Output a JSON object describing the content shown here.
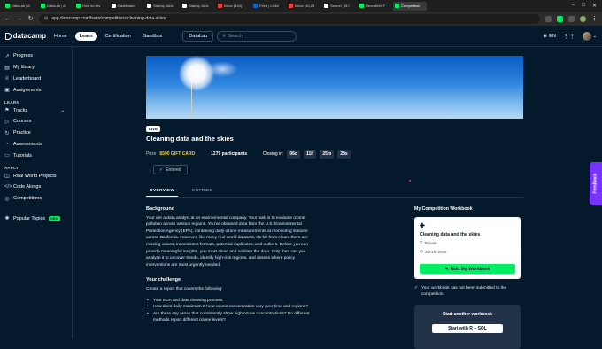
{
  "browser": {
    "tabs": [
      {
        "label": "DataLab | A",
        "color": "#03ef62"
      },
      {
        "label": "DataLab | A",
        "color": "#03ef62"
      },
      {
        "label": "How do res",
        "color": "#03ef62"
      },
      {
        "label": "Dashboard",
        "color": "#ffffff"
      },
      {
        "label": "Startup Jobs",
        "color": "#ffffff"
      },
      {
        "label": "Startup Jobs",
        "color": "#ffffff"
      },
      {
        "label": "Inbox (444)",
        "color": "#ea4335"
      },
      {
        "label": "Feed | Linke",
        "color": "#0a66c2"
      },
      {
        "label": "Inbox (40,23",
        "color": "#ea4335"
      },
      {
        "label": "Search | M.I",
        "color": "#ffffff"
      },
      {
        "label": "Recruiterd F",
        "color": "#03ef62"
      },
      {
        "label": "Competition",
        "color": "#03ef62"
      }
    ],
    "url": "app.datacamp.com/learn/competitions/cleaning-data-skies",
    "window_controls": {
      "minimize": "–",
      "maximize": "□",
      "close": "✕"
    }
  },
  "topbar": {
    "logo_text": "datacamp",
    "nav": [
      "Home",
      "Learn",
      "Certification",
      "Sandbox"
    ],
    "active_nav": "Learn",
    "datalab_label": "DataLab",
    "search_placeholder": "Search",
    "language": "EN"
  },
  "sidebar": {
    "group1": [
      {
        "label": "Progress",
        "icon": "progress-icon",
        "glyph": "↗"
      },
      {
        "label": "My library",
        "icon": "library-icon",
        "glyph": "▤"
      },
      {
        "label": "Leaderboard",
        "icon": "leaderboard-icon",
        "glyph": "♕"
      },
      {
        "label": "Assignments",
        "icon": "assignments-icon",
        "glyph": "▣"
      }
    ],
    "learn_heading": "LEARN",
    "group2": [
      {
        "label": "Tracks",
        "icon": "tracks-icon",
        "glyph": "⚑"
      },
      {
        "label": "Courses",
        "icon": "courses-icon",
        "glyph": "▷"
      },
      {
        "label": "Practice",
        "icon": "practice-icon",
        "glyph": "↻"
      },
      {
        "label": "Assessments",
        "icon": "assessments-icon",
        "glyph": "◔"
      },
      {
        "label": "Tutorials",
        "icon": "tutorials-icon",
        "glyph": "▭"
      }
    ],
    "apply_heading": "APPLY",
    "group3": [
      {
        "label": "Real World Projects",
        "icon": "projects-icon",
        "glyph": "◫"
      },
      {
        "label": "Code Alongs",
        "icon": "code-alongs-icon",
        "glyph": "</>"
      },
      {
        "label": "Competitions",
        "icon": "competitions-icon",
        "glyph": "◎"
      }
    ],
    "popular_topics": "Popular Topics",
    "new_badge": "NEW"
  },
  "competition": {
    "live_badge": "LIVE",
    "title": "Cleaning data and the skies",
    "prize_label": "Prize",
    "prize_value": "$500 GIFT CARD",
    "participants": "1279 participants",
    "closing_label": "Closing in:",
    "countdown": [
      "06d",
      "11h",
      "25m",
      "28s"
    ],
    "entered_label": "Entered",
    "tabs": [
      "OVERVIEW",
      "ENTRIES"
    ]
  },
  "overview": {
    "background_heading": "Background",
    "background_text": "Your are a data analyst at an environmental company. Your task is to evaluate ozone pollution across various regions. You've obtained data from the U.S. Environmental Protection Agency (EPA), containing daily ozone measurements at monitoring stations across California. However, like many real-world datasets, it's far from clean: there are missing values, inconsistent formats, potential duplicates, and outliers. Before you can provide meaningful insights, you must clean and validate the data. Only then can you analyze it to uncover trends, identify high-risk regions, and assess where policy interventions are most urgently needed.",
    "challenge_heading": "Your challenge",
    "challenge_intro": "Create a report that covers the following:",
    "challenge_items": [
      "Your EDA and data cleaning process.",
      "How does daily maximum 8-hour ozone concentration vary over time and regions?",
      "Are there any areas that consistently show high ozone concentrations? Do different methods report different ozone levels?"
    ]
  },
  "workbook": {
    "heading": "My Competition Workbook",
    "name": "Cleaning data and the skies",
    "privacy": "Private",
    "date": "Jul 19, 2025",
    "edit_label": "Edit My Workbook",
    "note": "Your workbook has not been submitted to the competition.",
    "another_title": "Start another workbook",
    "start_label": "Start with R + SQL"
  },
  "feedback_label": "Feedback"
}
